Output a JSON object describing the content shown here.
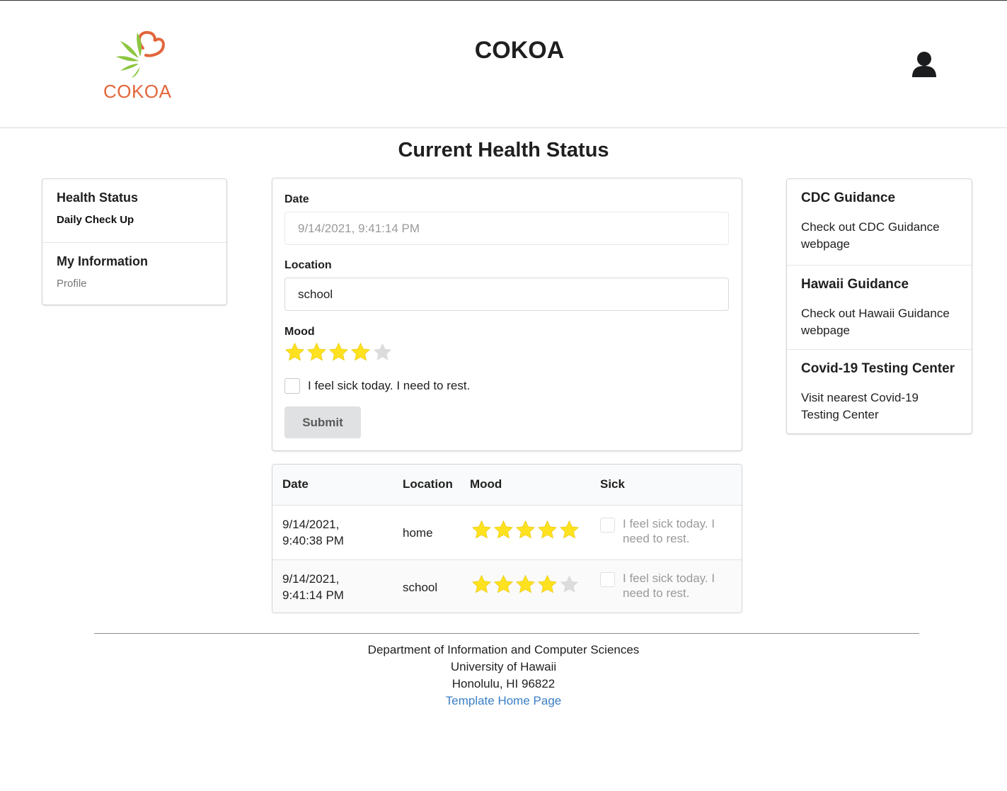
{
  "header": {
    "logo_text": "COKOA",
    "app_title": "COKOA"
  },
  "page_title": "Current Health Status",
  "left_menu": {
    "sections": [
      {
        "header": "Health Status",
        "item": "Daily Check Up"
      },
      {
        "header": "My Information",
        "item": "Profile"
      }
    ]
  },
  "form": {
    "date_label": "Date",
    "date_value": "9/14/2021, 9:41:14 PM",
    "location_label": "Location",
    "location_value": "school",
    "mood_label": "Mood",
    "mood_rating": 4,
    "mood_max": 5,
    "sick_label": "I feel sick today. I need to rest.",
    "sick_checked": false,
    "submit_label": "Submit"
  },
  "table": {
    "headers": [
      "Date",
      "Location",
      "Mood",
      "Sick"
    ],
    "rows": [
      {
        "date": "9/14/2021, 9:40:38 PM",
        "location": "home",
        "mood": 5,
        "sick_label": "I feel sick today. I need to rest.",
        "sick_checked": false
      },
      {
        "date": "9/14/2021, 9:41:14 PM",
        "location": "school",
        "mood": 4,
        "sick_label": "I feel sick today. I need to rest.",
        "sick_checked": false
      }
    ]
  },
  "right_menu": {
    "sections": [
      {
        "title": "CDC Guidance",
        "link": "Check out CDC Guidance webpage"
      },
      {
        "title": "Hawaii Guidance",
        "link": "Check out Hawaii Guidance webpage"
      },
      {
        "title": "Covid-19 Testing Center",
        "link": "Visit nearest Covid-19 Testing Center"
      }
    ]
  },
  "footer": {
    "line1": "Department of Information and Computer Sciences",
    "line2": "University of Hawaii",
    "line3": "Honolulu, HI 96822",
    "link": "Template Home Page"
  },
  "colors": {
    "star_filled": "#ffe21f",
    "star_empty": "#dcdcdc",
    "logo_orange": "#e2663b",
    "logo_green": "#8cc63f",
    "link": "#3a7fc4"
  }
}
